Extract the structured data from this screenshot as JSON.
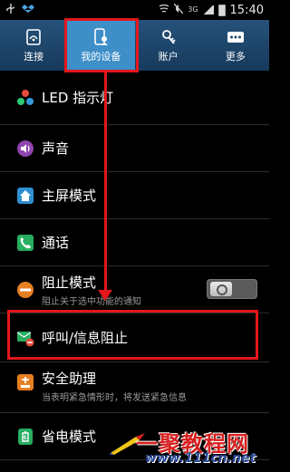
{
  "status_bar": {
    "time": "15:40",
    "network": "3G",
    "icons": [
      "usb-icon",
      "dropbox-icon",
      "nfc-icon",
      "mute-icon",
      "signal-icon",
      "battery-icon"
    ]
  },
  "tabs": [
    {
      "label": "连接",
      "icon": "connections-icon",
      "active": false
    },
    {
      "label": "我的设备",
      "icon": "my-device-icon",
      "active": true
    },
    {
      "label": "账户",
      "icon": "account-key-icon",
      "active": false
    },
    {
      "label": "更多",
      "icon": "more-icon",
      "active": false
    }
  ],
  "list": [
    {
      "title": "LED 指示灯",
      "icon": "led-icon"
    },
    {
      "title": "声音",
      "icon": "sound-icon"
    },
    {
      "title": "主屏模式",
      "icon": "home-screen-icon"
    },
    {
      "title": "通话",
      "icon": "phone-icon"
    },
    {
      "title": "阻止模式",
      "subtitle": "阻止关于选中功能的通知",
      "icon": "block-mode-icon",
      "toggle": "off"
    },
    {
      "title": "呼叫/信息阻止",
      "icon": "call-message-block-icon"
    },
    {
      "title": "安全助理",
      "subtitle": "当表明紧急情形时，将发送紧急信息",
      "icon": "safety-assistance-icon"
    },
    {
      "title": "省电模式",
      "icon": "power-saving-icon"
    }
  ],
  "watermark": {
    "main": "一聚教程网",
    "sub": "www.111cn.net"
  },
  "colors": {
    "tab_bar": "#1f4a72",
    "tab_active": "#3e8fc8",
    "annotation": "#e4171b",
    "background": "#000000"
  }
}
